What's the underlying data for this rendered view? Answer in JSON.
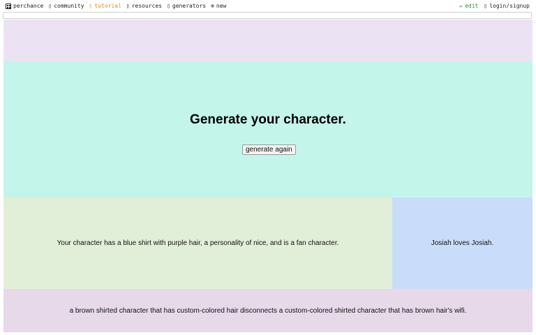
{
  "topbar": {
    "left": [
      {
        "icon": "dice-icon",
        "label": "perchance"
      },
      {
        "icon": "community-icon",
        "label": "community"
      },
      {
        "icon": "tutorial-icon",
        "label": "tutorial"
      },
      {
        "icon": "resources-icon",
        "label": "resources"
      },
      {
        "icon": "generators-icon",
        "label": "generators"
      },
      {
        "icon": "plus-circle-icon",
        "label": "new"
      }
    ],
    "right": [
      {
        "icon": "pencil-icon",
        "label": "edit"
      },
      {
        "icon": "user-icon",
        "label": "login/signup"
      }
    ]
  },
  "main": {
    "title": "Generate your character.",
    "button_label": "generate again"
  },
  "desc": {
    "text": "Your character has a blue shirt with purple hair, a personality of nice, and is a fan character."
  },
  "side": {
    "text": "Josiah loves Josiah."
  },
  "footer": {
    "text": "a brown shirted character that has custom-colored hair disconnects a custom-colored shirted character that has brown hair's wifi."
  },
  "colors": {
    "header_bg": "#ebe3f4",
    "main_bg": "#c4f5ea",
    "desc_bg": "#e1efd8",
    "side_bg": "#c9ddfa",
    "footer_bg": "#e7d8ea",
    "tutorial_accent": "#e58a1f",
    "edit_accent": "#2e8b2e"
  }
}
